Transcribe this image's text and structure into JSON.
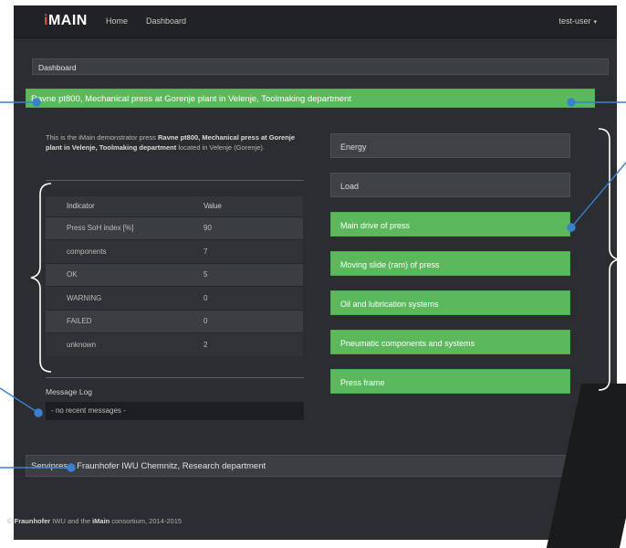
{
  "navbar": {
    "brand_mark": "i",
    "brand_text": "MAIN",
    "links": [
      "Home",
      "Dashboard"
    ],
    "user": "test-user",
    "user_caret": "▾"
  },
  "breadcrumb": "Dashboard",
  "press": {
    "title": "Ravne pt800, Mechanical press at Gorenje plant in Velenje, Toolmaking department",
    "intro_prefix": "This is the iMain demonstrator press",
    "intro_bold": "Ravne pt800, Mechanical press at Gorenje plant in Velenje, Toolmaking department",
    "intro_suffix": "located in Velenje (Gorenje)."
  },
  "indicators": {
    "headers": [
      "Indicator",
      "Value"
    ],
    "rows": [
      [
        "Press SoH index [%]",
        "90"
      ],
      [
        "components",
        "7"
      ],
      [
        "OK",
        "5"
      ],
      [
        "WARNING",
        "0"
      ],
      [
        "FAILED",
        "0"
      ],
      [
        "unknown",
        "2"
      ]
    ]
  },
  "message_log": {
    "title": "Message Log",
    "text": "- no recent messages -"
  },
  "components": [
    {
      "label": "Energy",
      "status": "gray"
    },
    {
      "label": "Load",
      "status": "gray"
    },
    {
      "label": "Main drive of press",
      "status": "green"
    },
    {
      "label": "Moving slide (ram) of press",
      "status": "green"
    },
    {
      "label": "Oil and lubrication systems",
      "status": "green"
    },
    {
      "label": "Pneumatic components and systems",
      "status": "green"
    },
    {
      "label": "Press frame",
      "status": "green"
    }
  ],
  "service": "Servipress, Fraunhofer IWU Chemnitz, Research department",
  "footer": {
    "prefix": "© ",
    "org": "Fraunhofer",
    "mid": " IWU and the ",
    "project": "iMain",
    "suffix": " consortium, 2014-2015"
  },
  "colors": {
    "ok": "#5cb85c",
    "neutral": "#3e4145",
    "background": "#2b2d30",
    "annotation": "#3a7fd0"
  }
}
